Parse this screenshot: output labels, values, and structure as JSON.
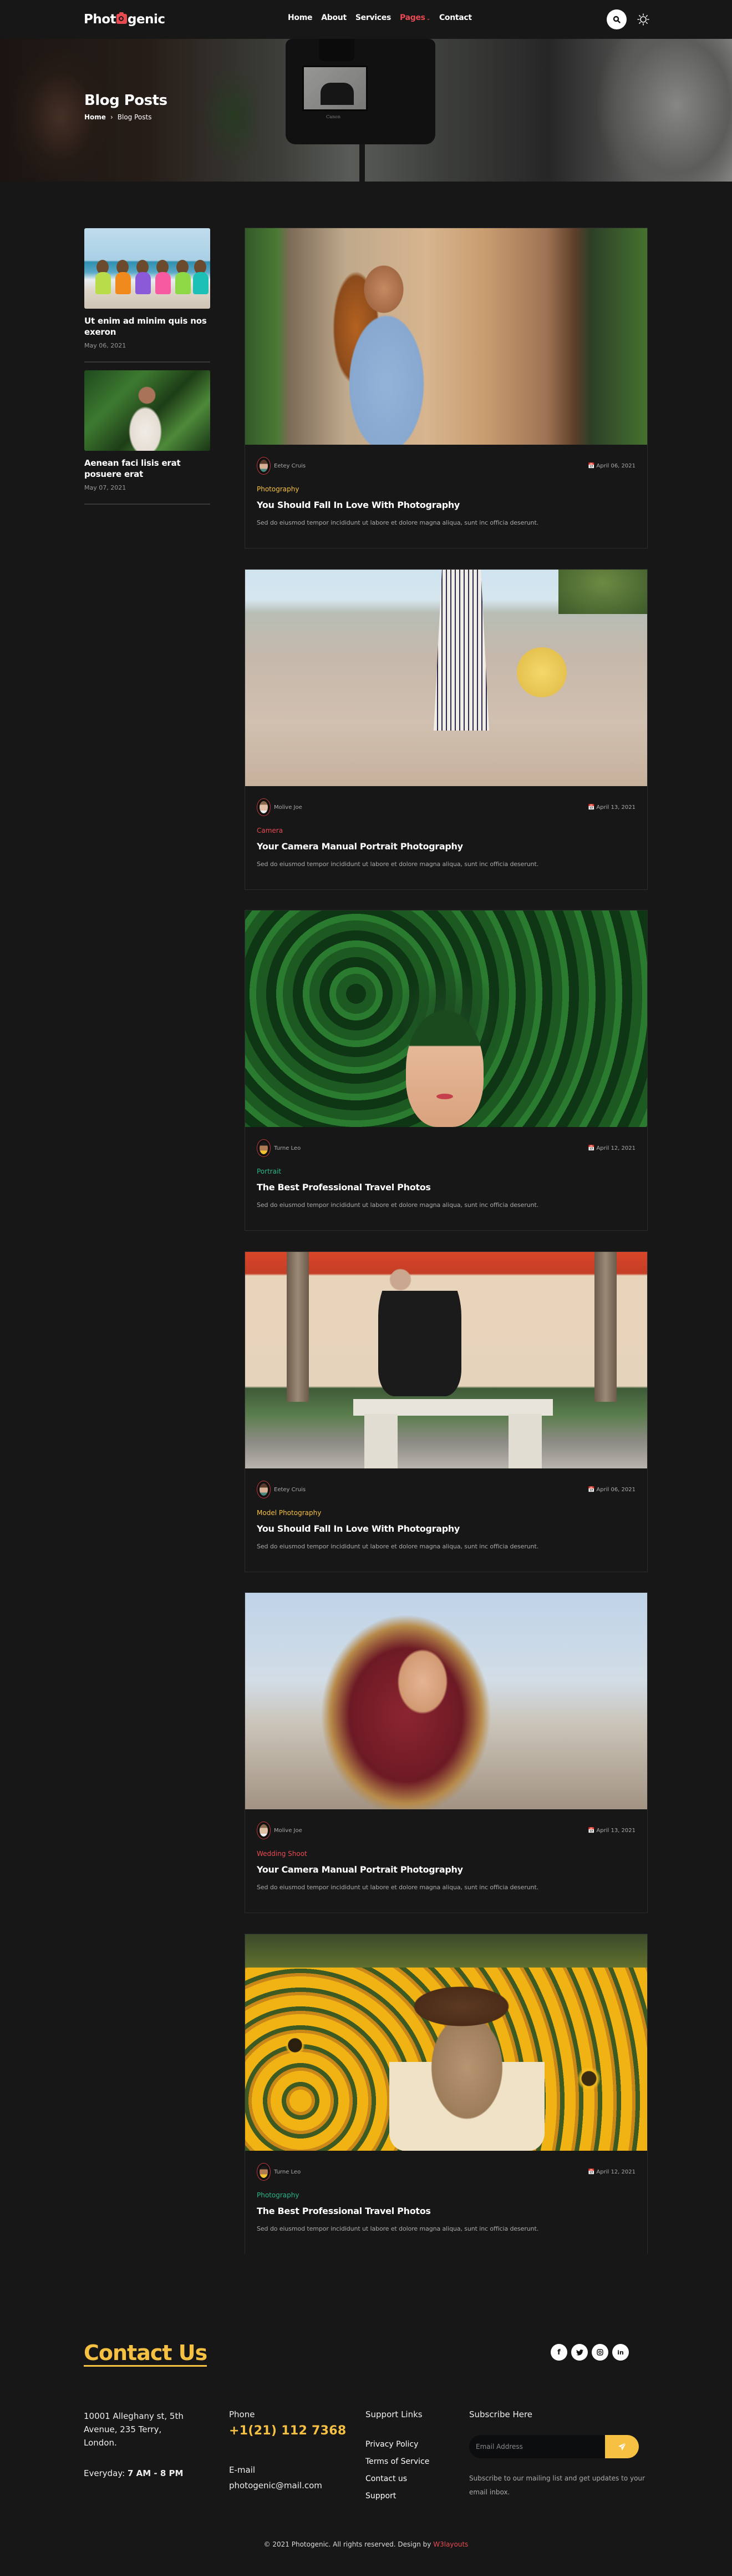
{
  "header": {
    "logo": {
      "prefix": "Phot",
      "suffix": "genic",
      "icon": "camera-icon"
    },
    "nav": [
      {
        "label": "Home",
        "active": false
      },
      {
        "label": "About",
        "active": false
      },
      {
        "label": "Services",
        "active": false
      },
      {
        "label": "Pages",
        "active": true,
        "has_dropdown": true
      },
      {
        "label": "Contact",
        "active": false
      }
    ],
    "search_icon": "search-icon",
    "theme_icon": "sun-icon"
  },
  "hero": {
    "title": "Blog Posts",
    "breadcrumb": {
      "home": "Home",
      "separator": "›",
      "current": "Blog Posts"
    },
    "camera_brand": "Canon"
  },
  "sidebar": {
    "posts": [
      {
        "title": "Ut enim ad minim quis nos exeron",
        "date": "May 06, 2021"
      },
      {
        "title": "Aenean faci lisis erat posuere erat",
        "date": "May 07, 2021"
      }
    ]
  },
  "posts": [
    {
      "author": "Eetey Cruis",
      "date": "April 06, 2021",
      "category": "Photography",
      "category_color": "#f6c142",
      "title": "You Should Fall In Love With Photography",
      "excerpt": "Sed do eiusmod tempor incididunt ut labore et dolore magna aliqua, sunt inc officia deserunt."
    },
    {
      "author": "Molive Joe",
      "date": "April 13, 2021",
      "category": "Camera",
      "category_color": "#e84a52",
      "title": "Your Camera Manual Portrait Photography",
      "excerpt": "Sed do eiusmod tempor incididunt ut labore et dolore magna aliqua, sunt inc officia deserunt."
    },
    {
      "author": "Turne Leo",
      "date": "April 12, 2021",
      "category": "Portrait",
      "category_color": "#2bb58a",
      "title": "The Best Professional Travel Photos",
      "excerpt": "Sed do eiusmod tempor incididunt ut labore et dolore magna aliqua, sunt inc officia deserunt."
    },
    {
      "author": "Eetey Cruis",
      "date": "April 06, 2021",
      "category": "Model Photography",
      "category_color": "#f6c142",
      "title": "You Should Fall In Love With Photography",
      "excerpt": "Sed do eiusmod tempor incididunt ut labore et dolore magna aliqua, sunt inc officia deserunt."
    },
    {
      "author": "Molive Joe",
      "date": "April 13, 2021",
      "category": "Wedding Shoot",
      "category_color": "#e84a52",
      "title": "Your Camera Manual Portrait Photography",
      "excerpt": "Sed do eiusmod tempor incididunt ut labore et dolore magna aliqua, sunt inc officia deserunt."
    },
    {
      "author": "Turne Leo",
      "date": "April 12, 2021",
      "category": "Photography",
      "category_color": "#2bb58a",
      "title": "The Best Professional Travel Photos",
      "excerpt": "Sed do eiusmod tempor incididunt ut labore et dolore magna aliqua, sunt inc officia deserunt."
    }
  ],
  "footer": {
    "contact_title": "Contact Us",
    "socials": [
      {
        "name": "facebook",
        "glyph": "f"
      },
      {
        "name": "twitter",
        "glyph": "t"
      },
      {
        "name": "instagram",
        "glyph": "◎"
      },
      {
        "name": "linkedin",
        "glyph": "in"
      }
    ],
    "address": "10001 Alleghany st, 5th Avenue, 235 Terry, London.",
    "hours_label": "Everyday:",
    "hours_value": "7 AM - 8 PM",
    "phone_label": "Phone",
    "phone": "+1(21) 112 7368",
    "email_label": "E-mail",
    "email": "photogenic@mail.com",
    "support_heading": "Support Links",
    "support_links": [
      "Privacy Policy",
      "Terms of Service",
      "Contact us",
      "Support"
    ],
    "subscribe_heading": "Subscribe Here",
    "subscribe_placeholder": "Email Address",
    "subscribe_note": "Subscribe to our mailing list and get updates to your email inbox.",
    "copyright": "© 2021 Photogenic. All rights reserved. Design by",
    "designer": "W3layouts"
  },
  "colors": {
    "accent_red": "#e84a52",
    "accent_yellow": "#f6c142",
    "accent_green": "#2bb58a",
    "background": "#171717"
  }
}
